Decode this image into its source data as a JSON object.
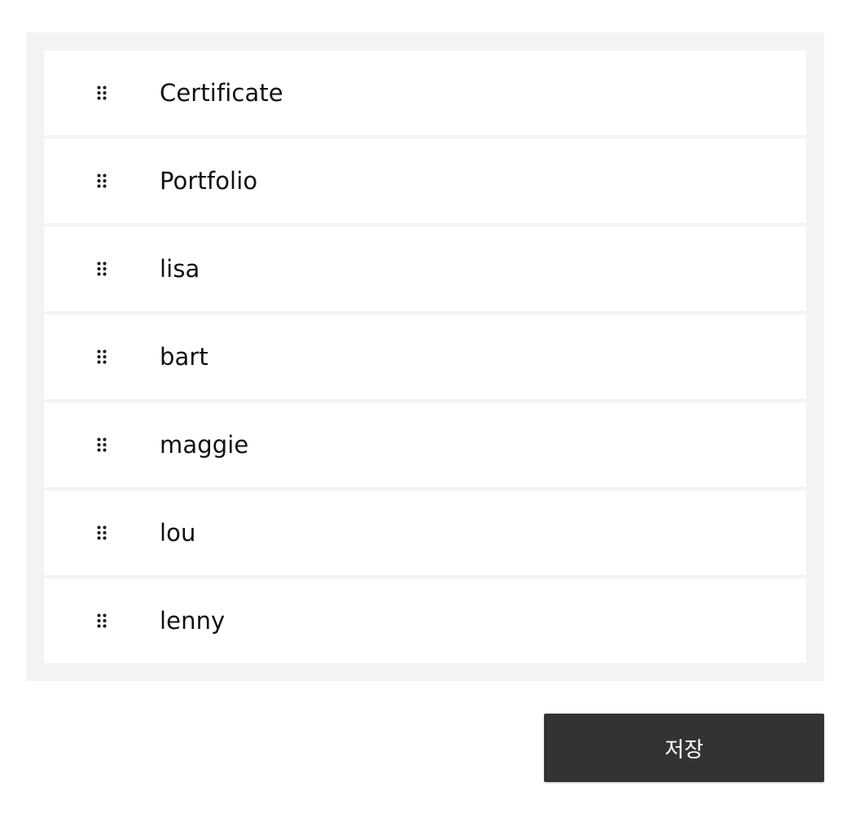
{
  "list": {
    "items": [
      {
        "label": "Certificate",
        "icon": "drag-handle-icon"
      },
      {
        "label": "Portfolio",
        "icon": "drag-handle-icon"
      },
      {
        "label": "lisa",
        "icon": "drag-handle-icon"
      },
      {
        "label": "bart",
        "icon": "drag-handle-icon"
      },
      {
        "label": "maggie",
        "icon": "drag-handle-icon"
      },
      {
        "label": "lou",
        "icon": "drag-handle-icon"
      },
      {
        "label": "lenny",
        "icon": "drag-handle-icon"
      }
    ]
  },
  "actions": {
    "save_label": "저장"
  },
  "colors": {
    "panel_background": "#f3f3f3",
    "item_background": "#ffffff",
    "button_background": "#333333",
    "button_text": "#ffffff"
  }
}
